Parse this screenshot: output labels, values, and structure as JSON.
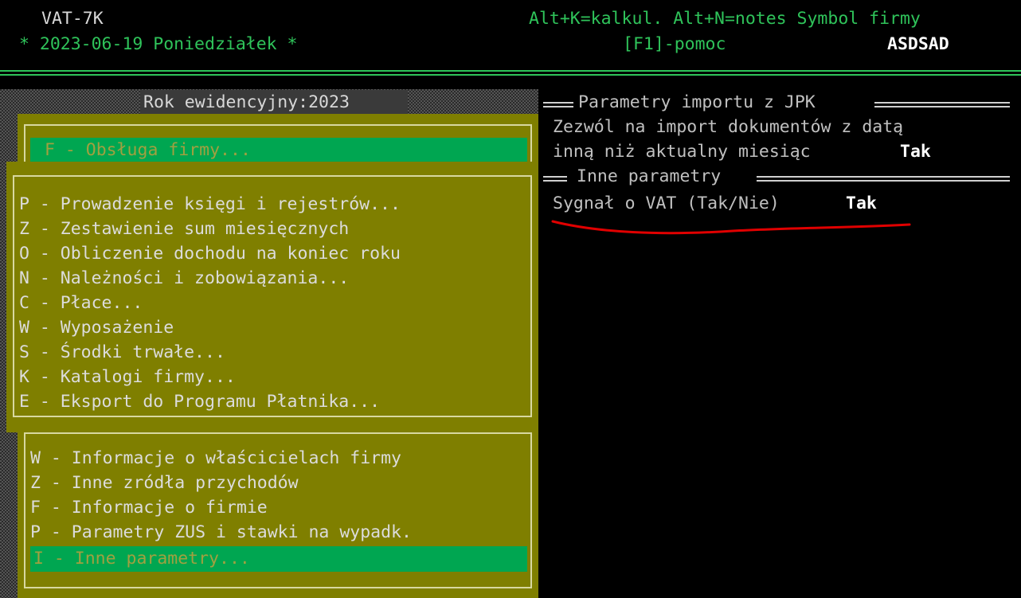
{
  "header": {
    "program": "VAT-7K",
    "date_line": "* 2023-06-19 Poniedziałek *",
    "shortcuts": "Alt+K=kalkul. Alt+N=notes Symbol firmy",
    "help": "[F1]-pomoc",
    "company_symbol": "ASDSAD"
  },
  "left": {
    "year_label": "Rok ewidencyjny:2023",
    "top_menu_selected": "F - Obsługa firmy...",
    "main_menu": [
      "P - Prowadzenie księgi i rejestrów...",
      "Z - Zestawienie sum miesięcznych",
      "O - Obliczenie dochodu na koniec roku",
      "N - Należności i zobowiązania...",
      "C - Płace...",
      "W - Wyposażenie",
      "S - Środki trwałe...",
      "K - Katalogi firmy...",
      "E - Eksport do Programu Płatnika..."
    ],
    "sub_menu": [
      "W - Informacje o właścicielach firmy",
      "Z - Inne zródła przychodów",
      "F - Informacje o firmie",
      "P - Parametry ZUS i stawki na wypadk."
    ],
    "sub_menu_selected": "I - Inne parametry..."
  },
  "right": {
    "jpk_title": "Parametry importu z JPK",
    "jpk_line1": "Zezwól na import dokumentów z datą",
    "jpk_line2": "inną niż aktualny miesiąc",
    "jpk_value": "Tak",
    "other_title": "Inne parametry",
    "vat_signal_label": "Sygnał o VAT (Tak/Nie)",
    "vat_signal_value": "Tak"
  },
  "colors": {
    "accent_green": "#2fc35a",
    "menu_olive": "#7f7f00",
    "selection_green": "#00a651",
    "annotation_red": "#e00000"
  }
}
